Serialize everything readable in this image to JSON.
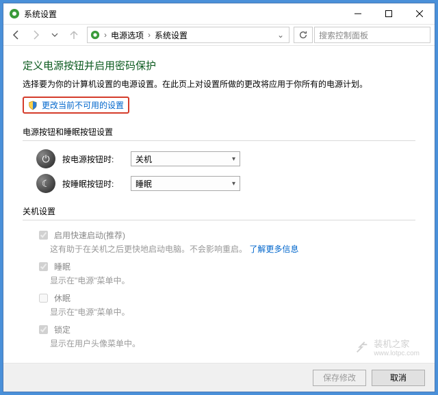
{
  "titlebar": {
    "title": "系统设置"
  },
  "breadcrumb": {
    "item1": "电源选项",
    "item2": "系统设置"
  },
  "search": {
    "placeholder": "搜索控制面板"
  },
  "heading": "定义电源按钮并启用密码保护",
  "description": "选择要为你的计算机设置的电源设置。在此页上对设置所做的更改将应用于你所有的电源计划。",
  "change_link": "更改当前不可用的设置",
  "section_buttons": "电源按钮和睡眠按钮设置",
  "power_button": {
    "label": "按电源按钮时:",
    "value": "关机"
  },
  "sleep_button": {
    "label": "按睡眠按钮时:",
    "value": "睡眠"
  },
  "section_shutdown": "关机设置",
  "opts": {
    "fast": {
      "label": "启用快速启动(推荐)",
      "desc_prefix": "这有助于在关机之后更快地启动电脑。不会影响重启。",
      "link": "了解更多信息"
    },
    "sleep": {
      "label": "睡眠",
      "desc": "显示在\"电源\"菜单中。"
    },
    "hiber": {
      "label": "休眠",
      "desc": "显示在\"电源\"菜单中。"
    },
    "lock": {
      "label": "锁定",
      "desc": "显示在用户头像菜单中。"
    }
  },
  "footer": {
    "save": "保存修改",
    "cancel": "取消"
  },
  "watermark": {
    "brand": "装机之家",
    "url": "www.lotpc.com"
  }
}
